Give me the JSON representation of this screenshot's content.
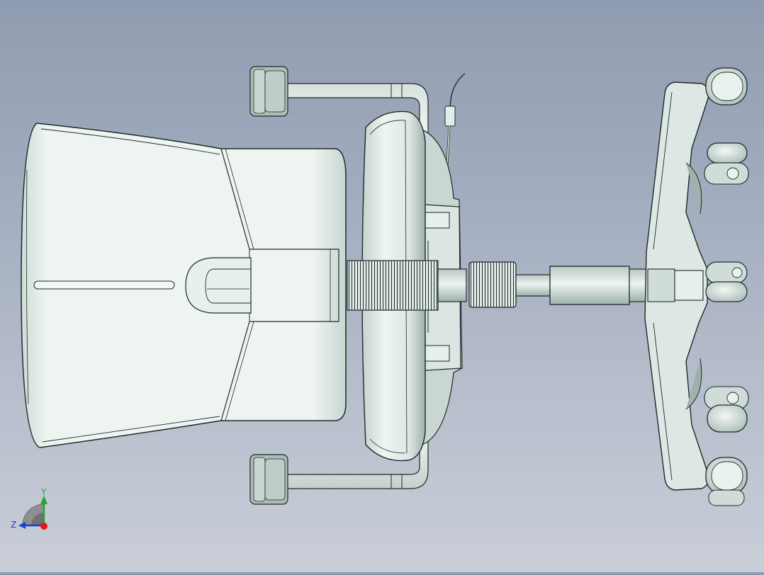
{
  "viewport": {
    "background_top": "#8f9bb0",
    "background_bottom": "#c9ced8"
  },
  "model": {
    "fill_color": "#e3ede9",
    "edge_color": "#1e2a2a",
    "shadow_color": "#b8c6c2"
  },
  "triad": {
    "y_label": "Y",
    "z_label": "Z",
    "y_color": "#1fa832",
    "z_color": "#1f3fd0",
    "x_color": "#e0161e"
  }
}
